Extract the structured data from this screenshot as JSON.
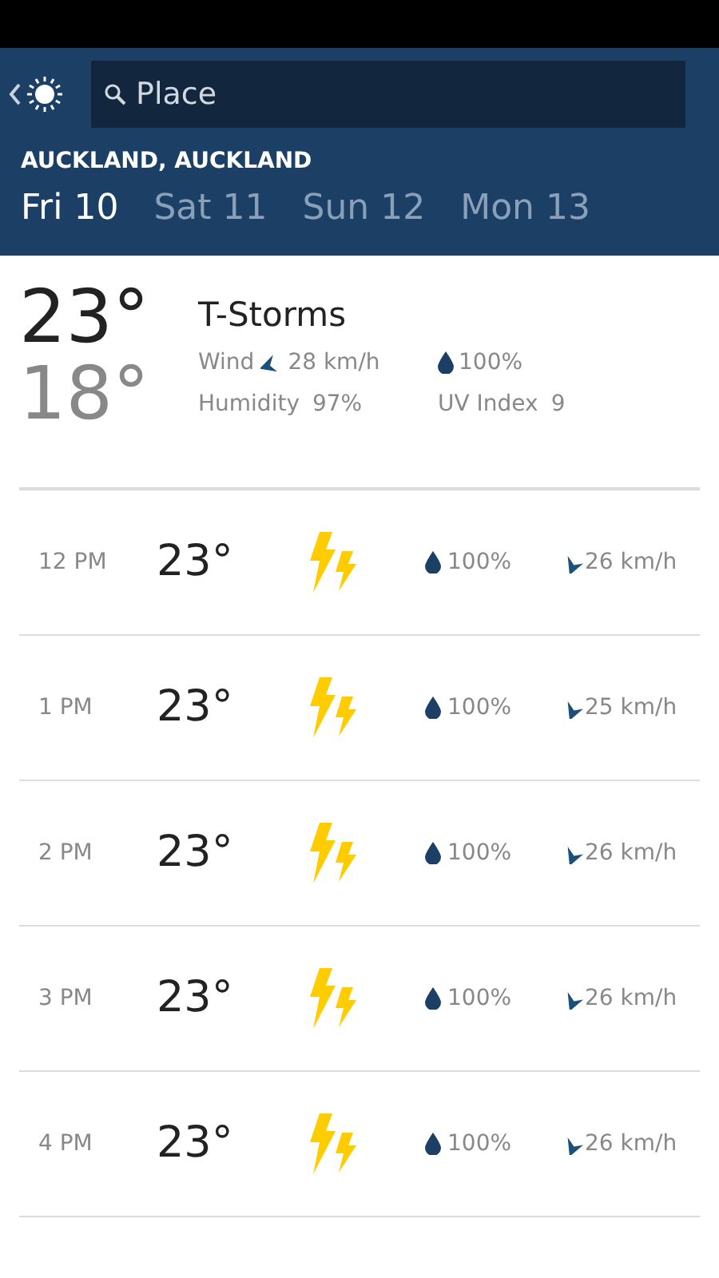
{
  "search": {
    "placeholder": "Place"
  },
  "location": "AUCKLAND, AUCKLAND",
  "days": [
    {
      "label": "Fri 10",
      "selected": true
    },
    {
      "label": "Sat 11",
      "selected": false
    },
    {
      "label": "Sun 12",
      "selected": false
    },
    {
      "label": "Mon 13",
      "selected": false
    }
  ],
  "current": {
    "high": "23°",
    "low": "18°",
    "condition": "T-Storms",
    "wind_label": "Wind",
    "wind": "28 km/h",
    "precip": "100%",
    "humidity_label": "Humidity",
    "humidity": "97%",
    "uv_label": "UV Index",
    "uv": "9"
  },
  "hours": [
    {
      "time": "12 PM",
      "temp": "23°",
      "precip": "100%",
      "wind": "26 km/h"
    },
    {
      "time": "1 PM",
      "temp": "23°",
      "precip": "100%",
      "wind": "25 km/h"
    },
    {
      "time": "2 PM",
      "temp": "23°",
      "precip": "100%",
      "wind": "26 km/h"
    },
    {
      "time": "3 PM",
      "temp": "23°",
      "precip": "100%",
      "wind": "26 km/h"
    },
    {
      "time": "4 PM",
      "temp": "23°",
      "precip": "100%",
      "wind": "26 km/h"
    }
  ]
}
